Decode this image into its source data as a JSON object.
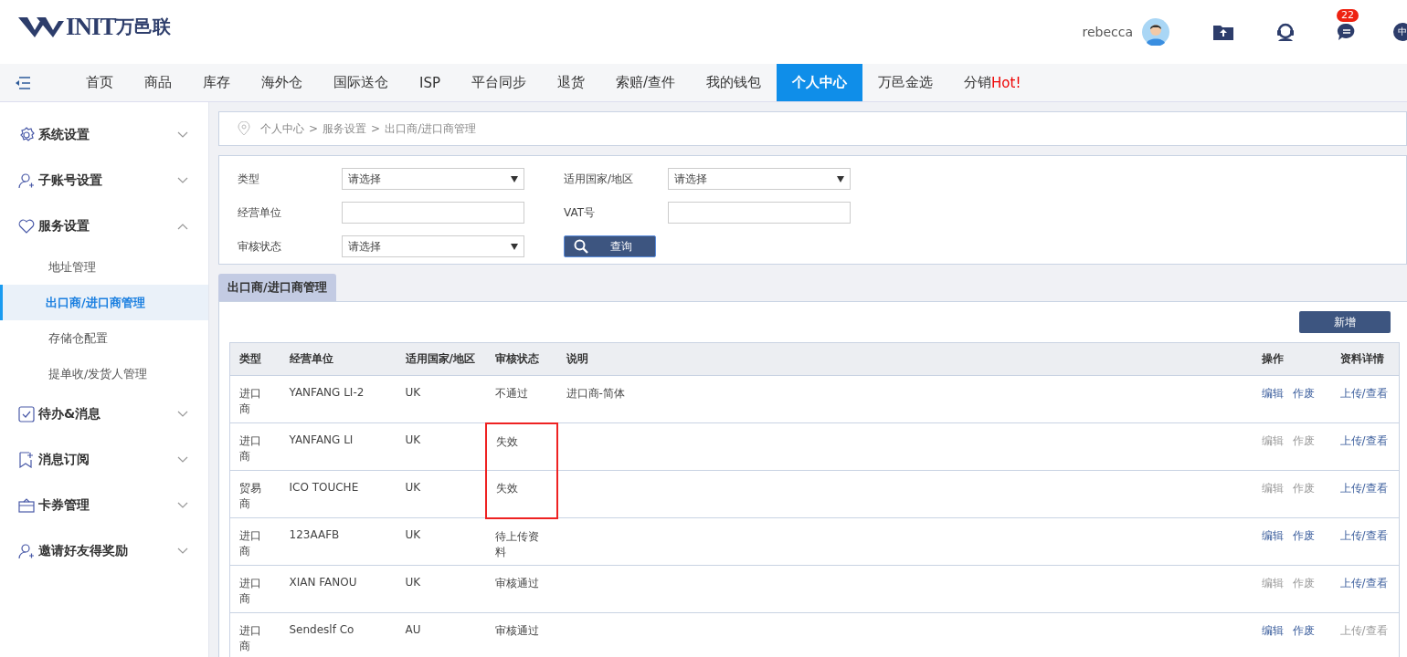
{
  "logo": {
    "mark": "INIT",
    "name": "万邑联"
  },
  "user": {
    "name": "rebecca",
    "badge": "22",
    "lang": "中"
  },
  "nav": [
    {
      "label": "首页",
      "selected": false
    },
    {
      "label": "商品",
      "selected": false
    },
    {
      "label": "库存",
      "selected": false
    },
    {
      "label": "海外仓",
      "selected": false
    },
    {
      "label": "国际送仓",
      "selected": false
    },
    {
      "label": "ISP",
      "selected": false
    },
    {
      "label": "平台同步",
      "selected": false
    },
    {
      "label": "退货",
      "selected": false
    },
    {
      "label": "索赔/查件",
      "selected": false
    },
    {
      "label": "我的钱包",
      "selected": false
    },
    {
      "label": "个人中心",
      "selected": true
    },
    {
      "label": "万邑金选",
      "selected": false
    },
    {
      "label": "分销",
      "hot": "Hot!",
      "selected": false
    }
  ],
  "sidebar": [
    {
      "label": "系统设置",
      "kind": "gear",
      "expanded": false
    },
    {
      "label": "子账号设置",
      "kind": "user",
      "expanded": false
    },
    {
      "label": "服务设置",
      "kind": "heart",
      "expanded": true,
      "children": [
        {
          "label": "地址管理",
          "selected": false
        },
        {
          "label": "出口商/进口商管理",
          "selected": true
        },
        {
          "label": "存储仓配置",
          "selected": false
        },
        {
          "label": "提单收/发货人管理",
          "selected": false
        }
      ]
    },
    {
      "label": "待办&消息",
      "kind": "check",
      "expanded": false
    },
    {
      "label": "消息订阅",
      "kind": "bookmark",
      "expanded": false
    },
    {
      "label": "卡券管理",
      "kind": "card",
      "expanded": false
    },
    {
      "label": "邀请好友得奖励",
      "kind": "user",
      "expanded": false
    }
  ],
  "breadcrumb": {
    "separator": ">",
    "items": [
      "个人中心",
      "服务设置",
      "出口商/进口商管理"
    ]
  },
  "filters": [
    {
      "label": "类型",
      "kind": "select",
      "value": "请选择"
    },
    {
      "label": "适用国家/地区",
      "kind": "select",
      "value": "请选择"
    },
    {
      "label": "经营单位",
      "kind": "input"
    },
    {
      "label": "VAT号",
      "kind": "input"
    },
    {
      "label": "审核状态",
      "kind": "select",
      "value": "请选择"
    }
  ],
  "search_button": "查询",
  "panel_tab": "出口商/进口商管理",
  "add_button": "新增",
  "table": {
    "columns": [
      "类型",
      "经营单位",
      "适用国家/地区",
      "审核状态",
      "说明",
      "操作",
      "资料详情"
    ],
    "rows": [
      {
        "type": "进口商",
        "company": "YANFANG LI-2",
        "region": "UK",
        "status": "不通过",
        "note": "进口商-简体",
        "edit": "编辑",
        "void": "作废",
        "actions_enabled": true,
        "detail": "上传/查看",
        "detail_enabled": true,
        "flagged": false
      },
      {
        "type": "进口商",
        "company": "YANFANG LI",
        "region": "UK",
        "status": "失效",
        "edit": "编辑",
        "void": "作废",
        "actions_enabled": false,
        "detail": "上传/查看",
        "detail_enabled": true,
        "flagged": true
      },
      {
        "type": "贸易商",
        "company": "ICO TOUCHE",
        "region": "UK",
        "status": "失效",
        "edit": "编辑",
        "void": "作废",
        "actions_enabled": false,
        "detail": "上传/查看",
        "detail_enabled": true,
        "flagged": true
      },
      {
        "type": "进口商",
        "company": "123AAFB",
        "region": "UK",
        "status": "待上传资料",
        "edit": "编辑",
        "void": "作废",
        "actions_enabled": true,
        "detail": "上传/查看",
        "detail_enabled": true,
        "flagged": false
      },
      {
        "type": "进口商",
        "company": "XIAN FANOU",
        "region": "UK",
        "status": "审核通过",
        "edit": "编辑",
        "void": "作废",
        "actions_enabled": false,
        "detail": "上传/查看",
        "detail_enabled": true,
        "flagged": false
      },
      {
        "type": "进口商",
        "company": "Sendeslf Co",
        "region": "AU",
        "status": "审核通过",
        "edit": "编辑",
        "void": "作废",
        "actions_enabled": true,
        "detail": "上传/查看",
        "detail_enabled": false,
        "flagged": false
      }
    ]
  }
}
